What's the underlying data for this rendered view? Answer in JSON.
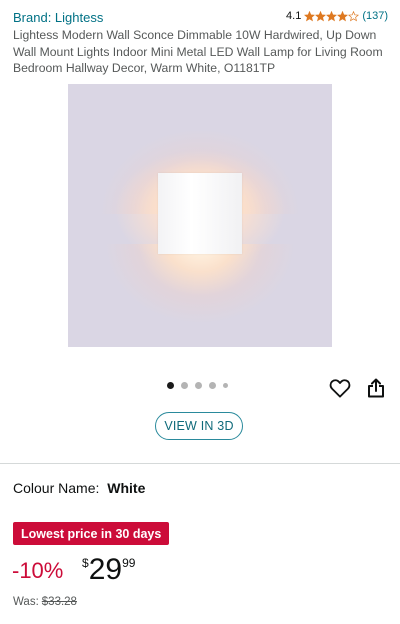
{
  "product": {
    "brand": "Brand: Lightess",
    "rating": "4.1",
    "stars": 4.1,
    "review_count": "(137)",
    "title": "Lightess Modern Wall Sconce Dimmable 10W Hardwired, Up Down Wall Mount Lights Indoor Mini Metal LED Wall Lamp for Living Room Bedroom Hallway Decor, Warm White, O1181TP"
  },
  "gallery": {
    "image_count": 5,
    "active_index": 0,
    "view_3d_label": "VIEW IN 3D"
  },
  "icons": {
    "wishlist": "heart-icon",
    "share": "share-icon",
    "rating": "star-icon"
  },
  "variant": {
    "label": "Colour Name:",
    "value": "White"
  },
  "pricing": {
    "deal_badge": "Lowest price in 30 days",
    "discount": "-10%",
    "currency": "$",
    "whole": "29",
    "fraction": "99",
    "was_label": "Was:",
    "was_price": "$33.28"
  },
  "colors": {
    "link": "#007185",
    "deal_red": "#cc0c39",
    "star": "#de7921",
    "view_3d_border": "#2a8a9c"
  }
}
